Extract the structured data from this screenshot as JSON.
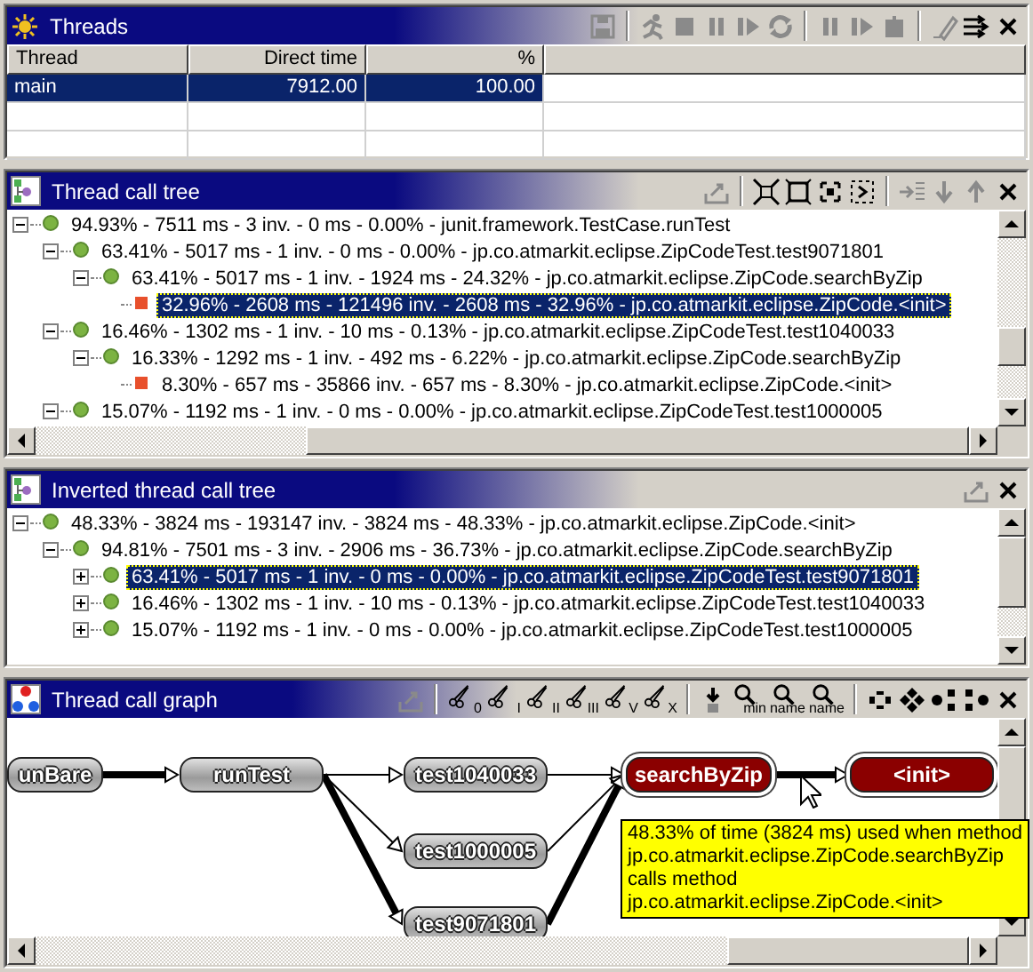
{
  "panels": [
    {
      "kind": "table",
      "title": "Threads",
      "toolbar": [
        {
          "kind": "floppy",
          "disabled": true
        },
        {
          "kind": "separator"
        },
        {
          "kind": "runner",
          "disabled": true
        },
        {
          "kind": "stop",
          "disabled": true
        },
        {
          "kind": "pause",
          "disabled": true
        },
        {
          "kind": "step",
          "disabled": true
        },
        {
          "kind": "cycle",
          "disabled": true
        },
        {
          "kind": "separator"
        },
        {
          "kind": "pause",
          "disabled": true
        },
        {
          "kind": "step",
          "disabled": true
        },
        {
          "kind": "box",
          "disabled": true
        },
        {
          "kind": "separator"
        },
        {
          "kind": "eraser",
          "disabled": true
        },
        {
          "kind": "arrows",
          "disabled": false
        },
        {
          "kind": "close",
          "disabled": false
        }
      ],
      "table": {
        "columns": [
          "Thread",
          "Direct time",
          "%"
        ],
        "rows": [
          {
            "cells": [
              "main",
              "7912.00",
              "100.00"
            ],
            "selected": true
          }
        ]
      }
    },
    {
      "kind": "tree",
      "title": "Thread call tree",
      "toolbar": [
        {
          "kind": "export",
          "disabled": true
        },
        {
          "kind": "separator"
        },
        {
          "kind": "collapse",
          "disabled": false
        },
        {
          "kind": "expand",
          "disabled": false
        },
        {
          "kind": "collapse-one",
          "disabled": false
        },
        {
          "kind": "expand-one",
          "disabled": false
        },
        {
          "kind": "separator"
        },
        {
          "kind": "next",
          "disabled": true
        },
        {
          "kind": "down",
          "disabled": true
        },
        {
          "kind": "up",
          "disabled": true
        },
        {
          "kind": "close",
          "disabled": false
        }
      ],
      "rows": [
        {
          "text": "94.93% - 7511 ms - 3 inv. - 0 ms - 0.00% - junit.framework.TestCase.runTest",
          "kind": "method",
          "expanded": true,
          "selected": false,
          "children": [
            {
              "text": "63.41% - 5017 ms - 1 inv. - 0 ms - 0.00% - jp.co.atmarkit.eclipse.ZipCodeTest.test9071801",
              "kind": "method",
              "expanded": true,
              "selected": false,
              "children": [
                {
                  "text": "63.41% - 5017 ms - 1 inv. - 1924 ms - 24.32% - jp.co.atmarkit.eclipse.ZipCode.searchByZip",
                  "kind": "method",
                  "expanded": true,
                  "selected": false,
                  "children": [
                    {
                      "text": "32.96% - 2608 ms - 121496 inv. - 2608 ms - 32.96% - jp.co.atmarkit.eclipse.ZipCode.<init>",
                      "kind": "leaf",
                      "selected": true
                    }
                  ]
                }
              ]
            },
            {
              "text": "16.46% - 1302 ms - 1 inv. - 10 ms - 0.13% - jp.co.atmarkit.eclipse.ZipCodeTest.test1040033",
              "kind": "method",
              "expanded": true,
              "selected": false,
              "children": [
                {
                  "text": "16.33% - 1292 ms - 1 inv. - 492 ms - 6.22% - jp.co.atmarkit.eclipse.ZipCode.searchByZip",
                  "kind": "method",
                  "expanded": true,
                  "selected": false,
                  "children": [
                    {
                      "text": "8.30% - 657 ms - 35866 inv. - 657 ms - 8.30% - jp.co.atmarkit.eclipse.ZipCode.<init>",
                      "kind": "leaf",
                      "selected": false
                    }
                  ]
                }
              ]
            },
            {
              "text": "15.07% - 1192 ms - 1 inv. - 0 ms - 0.00% - jp.co.atmarkit.eclipse.ZipCodeTest.test1000005",
              "kind": "method",
              "expanded": true,
              "selected": false
            }
          ]
        }
      ]
    },
    {
      "kind": "tree",
      "title": "Inverted thread call tree",
      "toolbar": [
        {
          "kind": "export",
          "disabled": true
        },
        {
          "kind": "close",
          "disabled": false
        }
      ],
      "rows": [
        {
          "text": "48.33% - 3824 ms - 193147 inv. - 3824 ms - 48.33% - jp.co.atmarkit.eclipse.ZipCode.<init>",
          "kind": "method",
          "expanded": true,
          "selected": false,
          "children": [
            {
              "text": "94.81% - 7501 ms - 3 inv. - 2906 ms - 36.73% - jp.co.atmarkit.eclipse.ZipCode.searchByZip",
              "kind": "method",
              "expanded": true,
              "selected": false,
              "children": [
                {
                  "text": "63.41% - 5017 ms - 1 inv. - 0 ms - 0.00% - jp.co.atmarkit.eclipse.ZipCodeTest.test9071801",
                  "kind": "method",
                  "expanded": false,
                  "selected": true
                },
                {
                  "text": "16.46% - 1302 ms - 1 inv. - 10 ms - 0.13% - jp.co.atmarkit.eclipse.ZipCodeTest.test1040033",
                  "kind": "method",
                  "expanded": false,
                  "selected": false
                },
                {
                  "text": "15.07% - 1192 ms - 1 inv. - 0 ms - 0.00% - jp.co.atmarkit.eclipse.ZipCodeTest.test1000005",
                  "kind": "method",
                  "expanded": false,
                  "selected": false
                }
              ]
            }
          ]
        }
      ]
    },
    {
      "kind": "graph",
      "title": "Thread call graph",
      "toolbar": [
        {
          "kind": "export",
          "disabled": true
        },
        {
          "kind": "separator"
        },
        {
          "kind": "scissors",
          "label": "0",
          "disabled": false
        },
        {
          "kind": "scissors",
          "label": "I",
          "disabled": false
        },
        {
          "kind": "scissors",
          "label": "II",
          "disabled": false
        },
        {
          "kind": "scissors",
          "label": "III",
          "disabled": false
        },
        {
          "kind": "scissors",
          "label": "V",
          "disabled": false
        },
        {
          "kind": "scissors",
          "label": "X",
          "disabled": false
        },
        {
          "kind": "separator"
        },
        {
          "kind": "pin",
          "disabled": false
        },
        {
          "kind": "magnifier",
          "label": "min",
          "disabled": false
        },
        {
          "kind": "magnifier",
          "label": "name",
          "disabled": false
        },
        {
          "kind": "magnifier",
          "label": "name",
          "disabled": false
        },
        {
          "kind": "separator"
        },
        {
          "kind": "layout-ring",
          "disabled": false
        },
        {
          "kind": "layout-diamond",
          "disabled": false
        },
        {
          "kind": "layout-left",
          "disabled": false
        },
        {
          "kind": "layout-right",
          "disabled": false
        },
        {
          "kind": "close",
          "disabled": false
        }
      ],
      "graph": {
        "nodes": [
          {
            "label": "unBare",
            "highlighted": false
          },
          {
            "label": "runTest",
            "highlighted": false
          },
          {
            "label": "test1040033",
            "highlighted": false
          },
          {
            "label": "test1000005",
            "highlighted": false
          },
          {
            "label": "test9071801",
            "highlighted": false
          },
          {
            "label": "searchByZip",
            "highlighted": true
          },
          {
            "label": "<init>",
            "highlighted": true
          }
        ],
        "edges": [
          {
            "heavy": true
          },
          {
            "heavy": false
          },
          {
            "heavy": false
          },
          {
            "heavy": true
          },
          {
            "heavy": false
          },
          {
            "heavy": false
          },
          {
            "heavy": true
          },
          {
            "heavy": true
          }
        ],
        "tooltip": [
          "48.33% of time (3824 ms) used when method",
          "jp.co.atmarkit.eclipse.ZipCode.searchByZip",
          "calls method",
          "jp.co.atmarkit.eclipse.ZipCode.<init>"
        ]
      }
    }
  ]
}
